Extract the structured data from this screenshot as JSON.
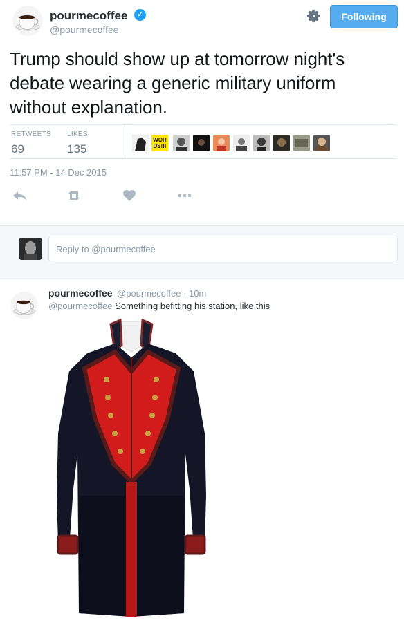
{
  "tweet": {
    "author": {
      "display_name": "pourmecoffee",
      "handle": "@pourmecoffee",
      "verified": true,
      "avatar_icon": "coffee-cup-icon"
    },
    "follow_button_label": "Following",
    "text": "Trump should show up at tomorrow night's debate wearing a generic military uniform without explanation.",
    "stats": {
      "retweets_label": "RETWEETS",
      "retweets": "69",
      "likes_label": "LIKES",
      "likes": "135"
    },
    "liker_badge_text_line1": "WOR",
    "liker_badge_text_line2": "DS!!!",
    "timestamp": "11:57 PM - 14 Dec 2015"
  },
  "reply_box": {
    "placeholder": "Reply to @pourmecoffee"
  },
  "reply": {
    "display_name": "pourmecoffee",
    "handle_time": "@pourmecoffee · 10m",
    "mention": "@pourmecoffee",
    "text": " Something befitting his station, like this",
    "media_description_icon": "military-coat-image"
  },
  "colors": {
    "accent": "#55acee",
    "verified": "#1da1f2",
    "muted": "#8899a6",
    "coat_red": "#d21c1c",
    "coat_navy": "#141628"
  }
}
